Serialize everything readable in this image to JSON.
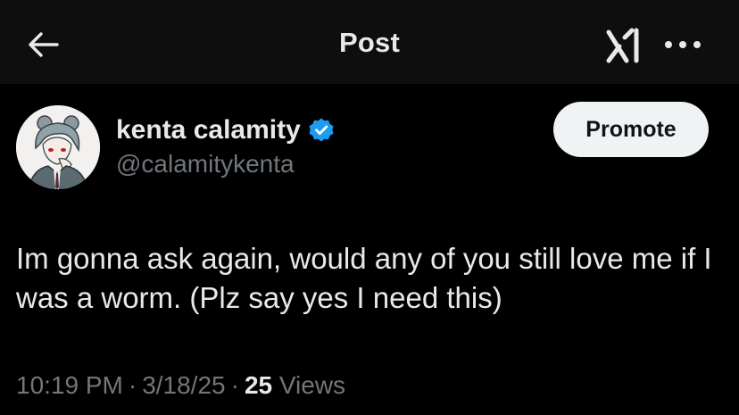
{
  "header": {
    "title": "Post"
  },
  "icons": {
    "back": "arrow-left-icon",
    "grok": "grok-icon",
    "more": "more-horizontal-icon",
    "verified": "verified-badge-icon"
  },
  "colors": {
    "background": "#000000",
    "header_background": "#0e0e0e",
    "text_primary": "#e7e9ea",
    "text_secondary": "#71767b",
    "verified_blue": "#1d9bf0",
    "promote_button_bg": "#eff3f4"
  },
  "author": {
    "display_name": "kenta calamity",
    "handle": "@calamitykenta",
    "verified": true
  },
  "actions": {
    "promote_label": "Promote"
  },
  "post": {
    "text": "Im gonna ask again, would any of you still love me if I was a worm. (Plz say yes I need this)",
    "time": "10:19 PM",
    "date": "3/18/25",
    "separator": "·",
    "views_count": "25",
    "views_label": "Views"
  }
}
